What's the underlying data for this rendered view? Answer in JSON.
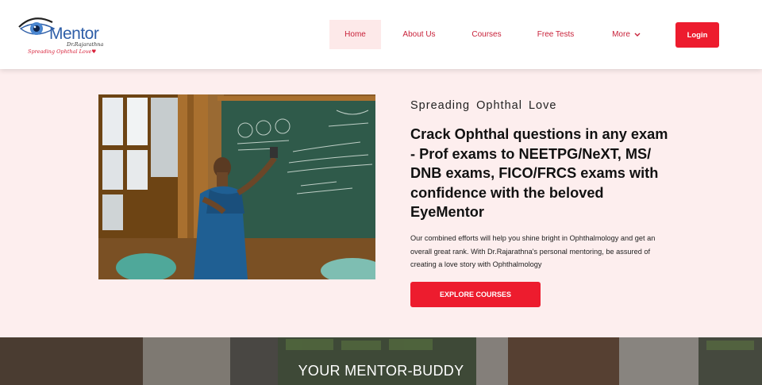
{
  "brand": {
    "logo_word": "Mentor",
    "logo_sub": "Dr.Rajarathna",
    "logo_tagline": "Spreading Ophthal Love♥"
  },
  "nav": {
    "home": "Home",
    "about": "About Us",
    "courses": "Courses",
    "free_tests": "Free Tests",
    "more": "More",
    "login": "Login"
  },
  "hero": {
    "tagline": "Spreading  Ophthal  Love",
    "title": "Crack Ophthal questions in any exam - Prof exams to NEETPG/NeXT, MS/ DNB exams, FICO/FRCS exams with confidence with the beloved EyeMentor",
    "description": "Our combined efforts will help you shine bright in Ophthalmology and get an overall great rank. With Dr.Rajarathna's personal mentoring, be assured of creating a love story with Ophthalmology",
    "cta": "EXPLORE COURSES"
  },
  "band": {
    "title": "YOUR MENTOR-BUDDY"
  },
  "colors": {
    "accent": "#ed1c2e",
    "hero_bg": "#fdeeee",
    "nav_text": "#c8223a"
  }
}
